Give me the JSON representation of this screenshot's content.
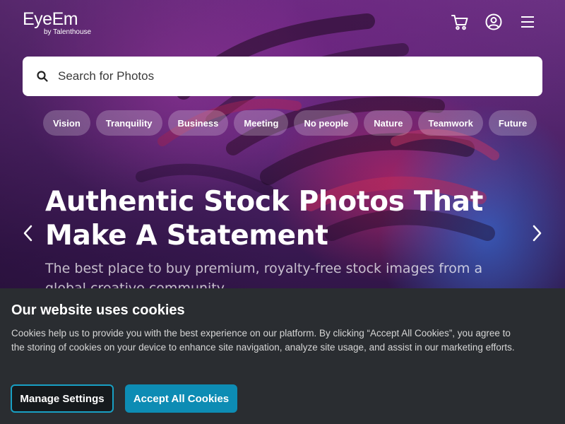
{
  "brand": {
    "name": "EyeEm",
    "sub": "by Talenthouse"
  },
  "header": {
    "icons": [
      "cart-icon",
      "account-icon",
      "menu-icon"
    ]
  },
  "search": {
    "placeholder": "Search for Photos"
  },
  "chips": [
    {
      "label": "Vision"
    },
    {
      "label": "Tranquility"
    },
    {
      "label": "Business"
    },
    {
      "label": "Meeting"
    },
    {
      "label": "No people"
    },
    {
      "label": "Nature"
    },
    {
      "label": "Teamwork"
    },
    {
      "label": "Future"
    }
  ],
  "hero": {
    "title": "Authentic Stock Photos That Make A Statement",
    "subtitle": "The best place to buy premium, royalty-free stock images from a global creative community"
  },
  "cookie": {
    "title": "Our website uses cookies",
    "text": "Cookies help us to provide you with the best experience on our platform. By clicking “Accept All Cookies”, you agree to the storing of cookies on your device to enhance site navigation, analyze site usage, and assist in our marketing efforts.",
    "manage_label": "Manage Settings",
    "accept_label": "Accept All Cookies"
  },
  "colors": {
    "accent": "#0d8cb4",
    "banner_bg": "#2a2d31"
  }
}
